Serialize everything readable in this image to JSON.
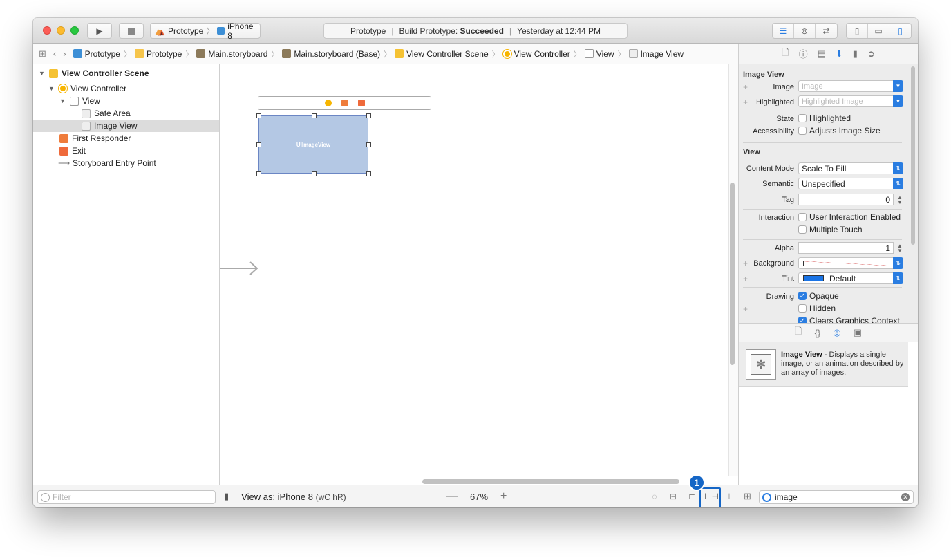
{
  "toolbar": {
    "scheme_project": "Prototype",
    "scheme_device": "iPhone 8",
    "status_project": "Prototype",
    "status_build_label": "Build Prototype:",
    "status_build_result": "Succeeded",
    "status_time": "Yesterday at 12:44 PM"
  },
  "jumpbar": {
    "crumbs": [
      "Prototype",
      "Prototype",
      "Main.storyboard",
      "Main.storyboard (Base)",
      "View Controller Scene",
      "View Controller",
      "View",
      "Image View"
    ]
  },
  "navigator": {
    "items": [
      {
        "label": "View Controller Scene"
      },
      {
        "label": "View Controller"
      },
      {
        "label": "View"
      },
      {
        "label": "Safe Area"
      },
      {
        "label": "Image View"
      },
      {
        "label": "First Responder"
      },
      {
        "label": "Exit"
      },
      {
        "label": "Storyboard Entry Point"
      }
    ],
    "filter_placeholder": "Filter"
  },
  "canvas": {
    "image_view_label": "UIImageView",
    "view_as": "View as: iPhone 8",
    "size_class": "(wC hR)",
    "zoom": "67%",
    "zoom_minus": "—",
    "zoom_plus": "+"
  },
  "annotation": {
    "badge": "1"
  },
  "inspector": {
    "image_view_section": "Image View",
    "image_label": "Image",
    "image_placeholder": "Image",
    "highlighted_label": "Highlighted",
    "highlighted_placeholder": "Highlighted Image",
    "state_label": "State",
    "state_option": "Highlighted",
    "accessibility_label": "Accessibility",
    "accessibility_option": "Adjusts Image Size",
    "view_section": "View",
    "content_mode_label": "Content Mode",
    "content_mode_value": "Scale To Fill",
    "semantic_label": "Semantic",
    "semantic_value": "Unspecified",
    "tag_label": "Tag",
    "tag_value": "0",
    "interaction_label": "Interaction",
    "interaction_opt1": "User Interaction Enabled",
    "interaction_opt2": "Multiple Touch",
    "alpha_label": "Alpha",
    "alpha_value": "1",
    "background_label": "Background",
    "tint_label": "Tint",
    "tint_value": "Default",
    "drawing_label": "Drawing",
    "drawing_opt1": "Opaque",
    "drawing_opt2": "Hidden",
    "drawing_opt3": "Clears Graphics Context"
  },
  "library": {
    "item_title": "Image View",
    "item_desc": " - Displays a single image, or an animation described by an array of images.",
    "search_value": "image"
  },
  "colors": {
    "accent": "#2a7de1",
    "annotation": "#1566c6",
    "image_view_fill": "#b4c8e4"
  }
}
